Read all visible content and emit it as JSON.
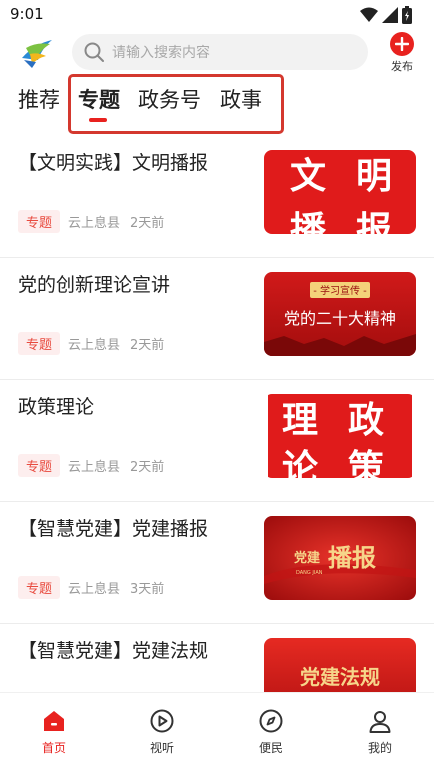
{
  "status": {
    "time": "9:01"
  },
  "search": {
    "placeholder": "请输入搜索内容"
  },
  "header": {
    "publish_label": "发布"
  },
  "tabs": [
    {
      "label": "推荐",
      "active": false
    },
    {
      "label": "专题",
      "active": true
    },
    {
      "label": "政务号",
      "active": false
    },
    {
      "label": "政事",
      "active": false
    }
  ],
  "feed": [
    {
      "title": "【文明实践】文明播报",
      "tag": "专题",
      "source": "云上息县",
      "time": "2天前",
      "thumb_text": [
        "文",
        "明",
        "播",
        "报"
      ]
    },
    {
      "title": "党的创新理论宣讲",
      "tag": "专题",
      "source": "云上息县",
      "time": "2天前",
      "thumb_banner": "- 学习宣传 -",
      "thumb_text": [
        "党的二十大精神"
      ]
    },
    {
      "title": "政策理论",
      "tag": "专题",
      "source": "云上息县",
      "time": "2天前",
      "thumb_text": [
        "理",
        "政",
        "论",
        "策"
      ]
    },
    {
      "title": "【智慧党建】党建播报",
      "tag": "专题",
      "source": "云上息县",
      "time": "3天前",
      "thumb_text": [
        "党建",
        "播报",
        "DANG JIAN"
      ]
    },
    {
      "title": "【智慧党建】党建法规",
      "thumb_text": [
        "党建法规"
      ]
    }
  ],
  "bottom_nav": [
    {
      "label": "首页",
      "icon": "home-icon",
      "active": true
    },
    {
      "label": "视听",
      "icon": "play-icon",
      "active": false
    },
    {
      "label": "便民",
      "icon": "compass-icon",
      "active": false
    },
    {
      "label": "我的",
      "icon": "user-icon",
      "active": false
    }
  ],
  "colors": {
    "accent": "#e8221f",
    "tag_bg": "#fdeeee",
    "highlight_border": "#d4382e"
  }
}
